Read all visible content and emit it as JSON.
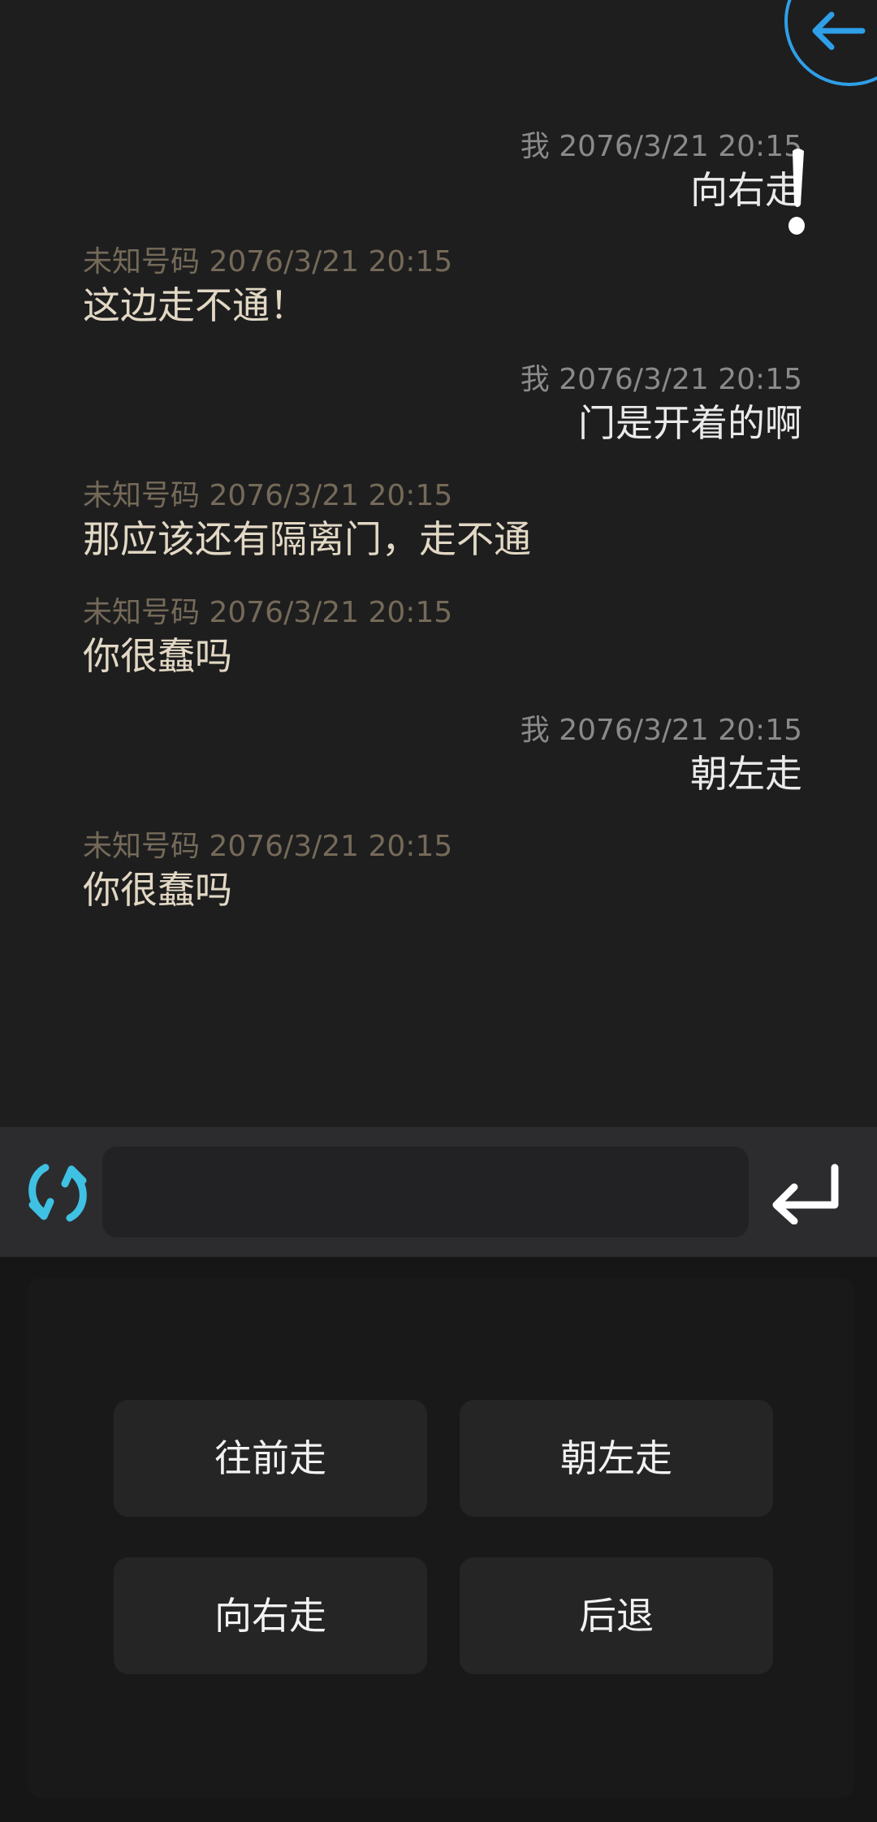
{
  "header": {
    "back_icon": "arrow-left-icon",
    "accent_color": "#2f9fe8"
  },
  "messages": [
    {
      "sender": "我",
      "time": "2076/3/21 20:15",
      "text": "向右走",
      "side": "me"
    },
    {
      "sender": "未知号码",
      "time": "2076/3/21 20:15",
      "text": "这边走不通！",
      "side": "other"
    },
    {
      "sender": "我",
      "time": "2076/3/21 20:15",
      "text": "门是开着的啊",
      "side": "me"
    },
    {
      "sender": "未知号码",
      "time": "2076/3/21 20:15",
      "text": "那应该还有隔离门，走不通",
      "side": "other"
    },
    {
      "sender": "未知号码",
      "time": "2076/3/21 20:15",
      "text": "你很蠢吗",
      "side": "other"
    },
    {
      "sender": "我",
      "time": "2076/3/21 20:15",
      "text": "朝左走",
      "side": "me"
    },
    {
      "sender": "未知号码",
      "time": "2076/3/21 20:15",
      "text": "你很蠢吗",
      "side": "other"
    }
  ],
  "input_bar": {
    "refresh_icon": "refresh-icon",
    "input_value": "",
    "send_icon": "enter-return-icon",
    "refresh_color": "#3fc1e3"
  },
  "options": [
    {
      "label": "往前走"
    },
    {
      "label": "朝左走"
    },
    {
      "label": "向右走"
    },
    {
      "label": "后退"
    }
  ]
}
